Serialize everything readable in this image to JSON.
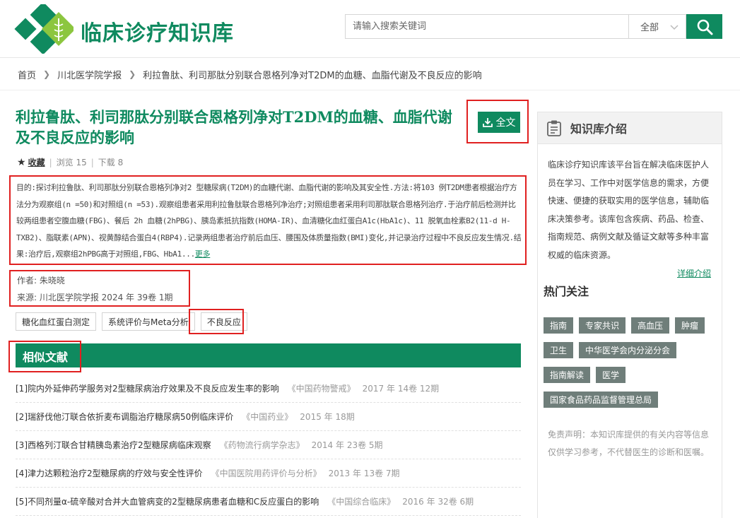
{
  "header": {
    "site_title": "临床诊疗知识库",
    "search_placeholder": "请输入搜索关键词",
    "search_scope": "全部",
    "brand_color": "#0f8a5f"
  },
  "breadcrumb": [
    "首页",
    "川北医学院学报",
    "利拉鲁肽、利司那肽分别联合恩格列净对T2DM的血糖、血脂代谢及不良反应的影响"
  ],
  "article": {
    "title": "利拉鲁肽、利司那肽分别联合恩格列净对T2DM的血糖、血脂代谢及不良反应的影响",
    "fulltext_label": "全文",
    "favorite_label": "收藏",
    "views_label": "浏览",
    "views": "15",
    "downloads_label": "下载",
    "downloads": "8",
    "abstract": "目的:探讨利拉鲁肽、利司那肽分别联合恩格列净对2 型糖尿病(T2DM)的血糖代谢、血脂代谢的影响及其安全性.方法:将103 例T2DM患者根据治疗方法分为观察组(n =50)和对照组(n =53).观察组患者采用利拉鲁肽联合恩格列净治疗;对照组患者采用利司那肽联合恩格列治疗.于治疗前后检测并比较两组患者空腹血糖(FBG)、餐后 2h 血糖(2hPBG)、胰岛素抵抗指数(HOMA-IR)、血清糖化血红蛋白A1c(HbA1c)、11 脱氧血栓素B2(11-d H-TXB2)、脂联素(APN)、视黄醇结合蛋白4(RBP4).记录两组患者治疗前后血压、腰围及体质量指数(BMI)变化,并记录治疗过程中不良反应发生情况.结果:治疗后,观察组2hPBG高于对照组,FBG、HbA1...",
    "more_label": "更多",
    "author_line": "作者: 朱晓晓",
    "source_line": "来源: 川北医学院学报  2024 年 39卷 1期",
    "tags": [
      "糖化血红蛋白测定",
      "系统评价与Meta分析",
      "不良反应"
    ]
  },
  "similar": {
    "heading": "相似文献",
    "items": [
      {
        "title": "[1]院内外延伸药学服务对2型糖尿病治疗效果及不良反应发生率的影响",
        "journal": "《中国药物警戒》",
        "info": "2017 年 14卷 12期"
      },
      {
        "title": "[2]瑞舒伐他汀联合依折麦布调脂治疗糖尿病50例临床评价",
        "journal": "《中国药业》",
        "info": "2015 年 18期"
      },
      {
        "title": "[3]西格列汀联合甘精胰岛素治疗2型糖尿病临床观察",
        "journal": "《药物流行病学杂志》",
        "info": "2014 年 23卷 5期"
      },
      {
        "title": "[4]津力达颗粒治疗2型糖尿病的疗效与安全性评价",
        "journal": "《中国医院用药评价与分析》",
        "info": "2013 年 13卷 7期"
      },
      {
        "title": "[5]不同剂量α-硫辛酸对合并大血管病变的2型糖尿病患者血糖和C反应蛋白的影响",
        "journal": "《中国综合临床》",
        "info": "2016 年 32卷 6期"
      }
    ]
  },
  "sidebar": {
    "title": "知识库介绍",
    "intro": "临床诊疗知识库该平台旨在解决临床医护人员在学习、工作中对医学信息的需求，方便快速、便捷的获取实用的医学信息，辅助临床决策参考。该库包含疾病、药品、检查、指南规范、病例文献及循证文献等多种丰富权威的临床资源。",
    "more_label": "详细介绍",
    "hot_title": "热门关注",
    "hot_tags": [
      "指南",
      "专家共识",
      "高血压",
      "肿瘤",
      "卫生",
      "中华医学会内分泌分会",
      "指南解读",
      "医学",
      "国家食品药品监督管理总局"
    ],
    "disclaimer": "免责声明：本知识库提供的有关内容等信息仅供学习参考，不代替医生的诊断和医嘱。"
  }
}
